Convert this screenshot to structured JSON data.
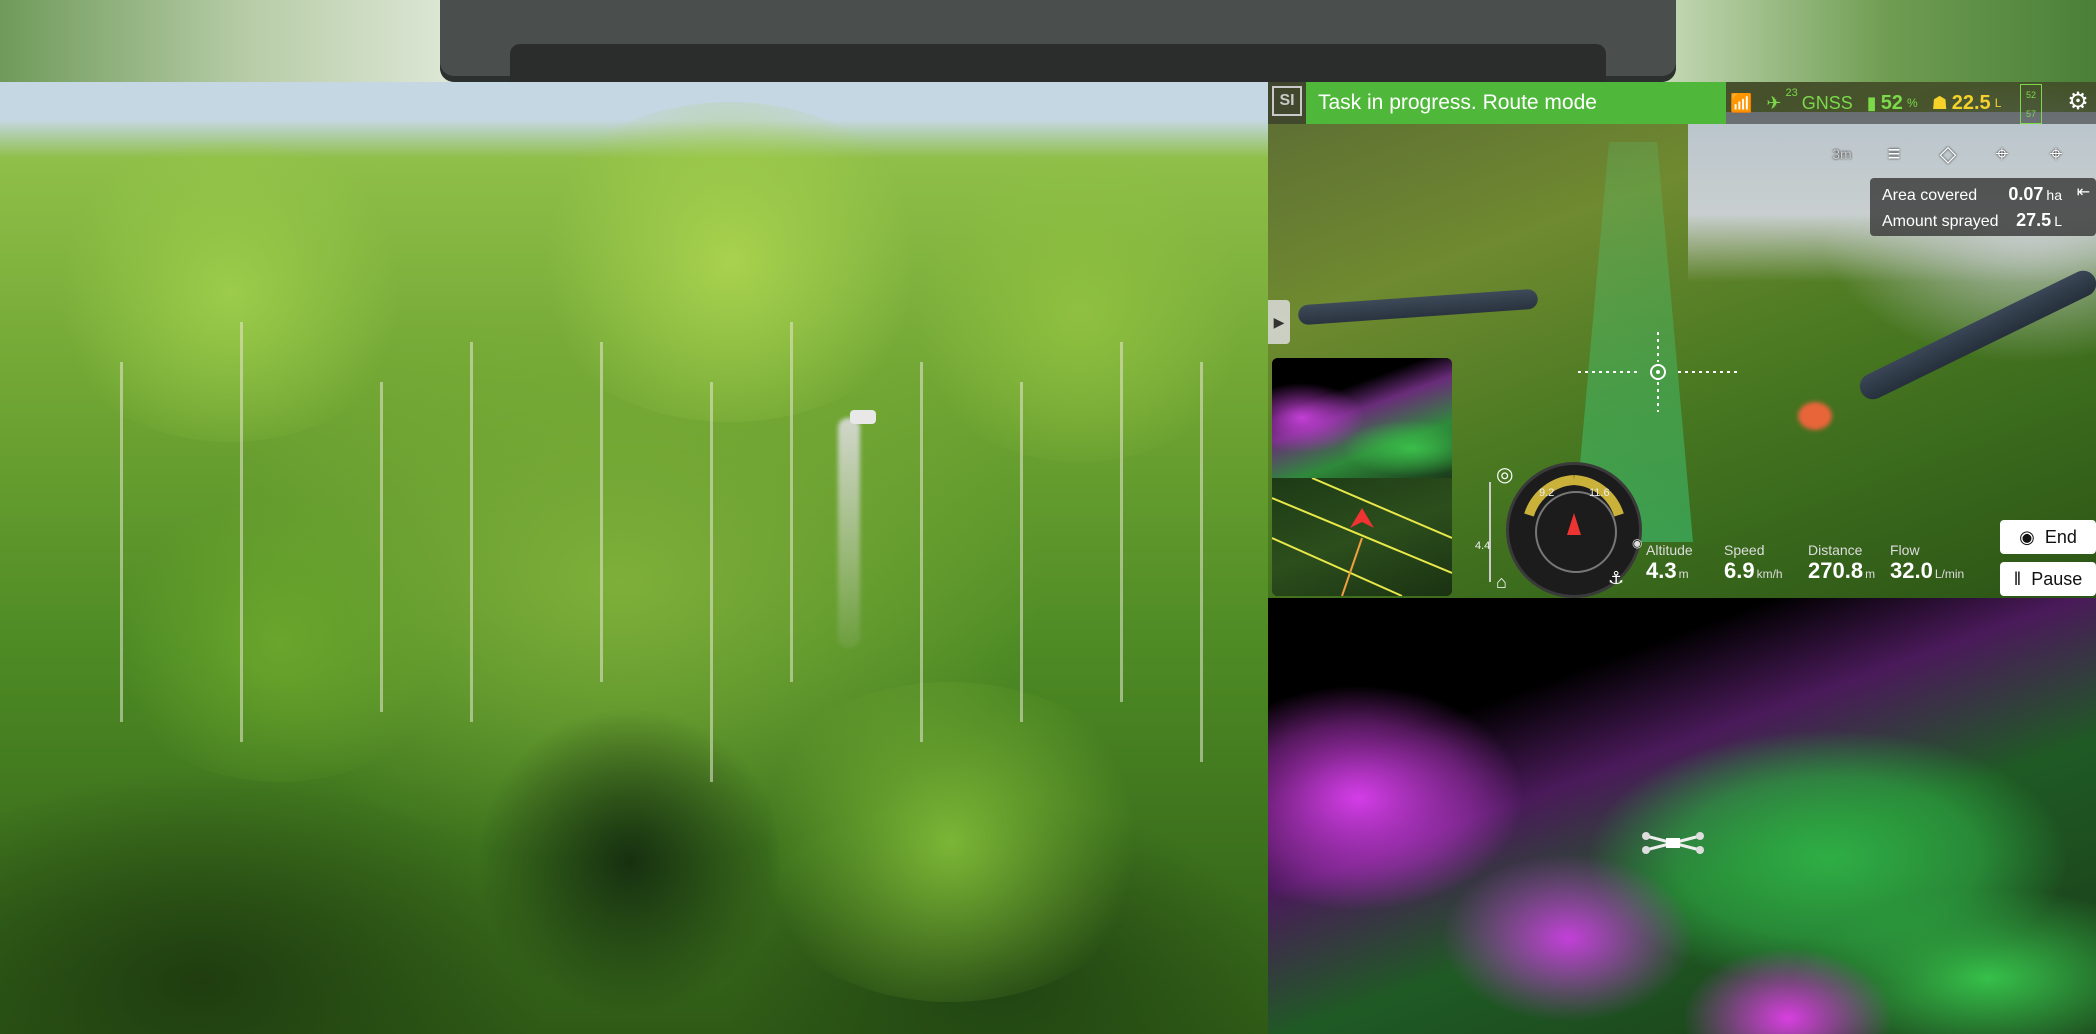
{
  "status_bar": {
    "logo": "SI",
    "task_banner": "Task in progress. Route mode",
    "gnss_count": "23",
    "gnss_label": "GNSS",
    "battery_percent": "52",
    "battery_unit": "%",
    "tank_value": "22.5",
    "tank_unit": "L",
    "mini_battery_top": "52",
    "mini_battery_bottom": "57"
  },
  "toolbar": {
    "altitude_chip": "3m",
    "tools": [
      "route-mode-icon",
      "erase-icon",
      "locate-icon",
      "drone-icon",
      "layers-icon"
    ]
  },
  "info_card": {
    "area_label": "Area covered",
    "area_value": "0.07",
    "area_unit": "ha",
    "sprayed_label": "Amount sprayed",
    "sprayed_value": "27.5",
    "sprayed_unit": "L"
  },
  "attitude": {
    "left_reading": "9.2",
    "right_reading": "11.6",
    "bar_reading": "4.4"
  },
  "telemetry": [
    {
      "label": "Altitude",
      "value": "4.3",
      "unit": "m"
    },
    {
      "label": "Speed",
      "value": "6.9",
      "unit": "km/h"
    },
    {
      "label": "Distance",
      "value": "270.8",
      "unit": "m"
    },
    {
      "label": "Flow",
      "value": "32.0",
      "unit": "L/min"
    }
  ],
  "actions": {
    "end_label": "End",
    "pause_label": "Pause"
  },
  "colors": {
    "accent_green": "#4fb83a",
    "warning_yellow": "#f4d22a",
    "pointcloud_magenta": "#d43de8",
    "pointcloud_green": "#2fae45"
  }
}
